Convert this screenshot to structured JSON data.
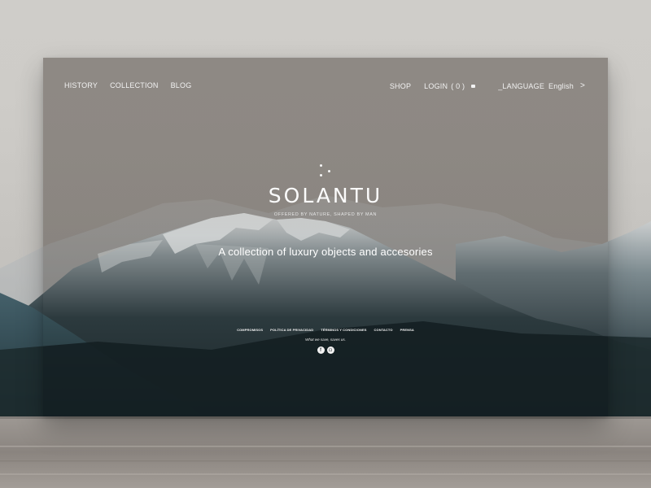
{
  "nav": {
    "left": [
      "HISTORY",
      "COLLECTION",
      "BLOG"
    ],
    "shop": "SHOP",
    "login": "LOGIN",
    "cart_count": "( 0 )",
    "language_label": "_LANGUAGE",
    "language_value": "English",
    "language_chevron": ">"
  },
  "hero": {
    "brand": "SOLANTU",
    "tagline": "OFFERED BY NATURE, SHAPED BY MAN",
    "headline": "A collection of  luxury objects and accesories"
  },
  "footer": {
    "links": [
      "COMPROMISOS",
      "POLÍTICA DE PRIVACIDAD",
      "TÉRMINOS Y CONDICIONES",
      "CONTACTO",
      "PRENSA"
    ],
    "slogan": "What we save, saves us.",
    "social": [
      "facebook-icon",
      "instagram-icon"
    ]
  },
  "colors": {
    "background": "#cfcdc9",
    "text": "#f2f2f2",
    "icon_fg": "#4a4f52"
  }
}
